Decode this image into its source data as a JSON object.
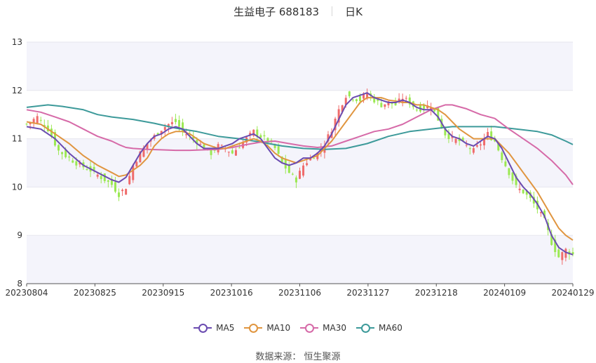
{
  "header": {
    "title": "生益电子 688183",
    "period": "日K"
  },
  "source": "数据来源： 恒生聚源",
  "colors": {
    "up": "#ef6b6b",
    "down": "#9be852",
    "grid_band": "#f4f4fb",
    "grid_line": "#e6e6ee",
    "axis": "#333333"
  },
  "chart_data": {
    "type": "candlestick",
    "title": "生益电子 688183",
    "period_label": "日K",
    "ylim": [
      8,
      13
    ],
    "y_ticks": [
      "8",
      "9",
      "10",
      "11",
      "12",
      "13"
    ],
    "x_tick_labels": [
      "20230804",
      "20230825",
      "20230915",
      "20231016",
      "20231106",
      "20231127",
      "20231218",
      "20240109",
      "20240129"
    ],
    "legend": [
      "MA5",
      "MA10",
      "MA30",
      "MA60"
    ],
    "legend_position": "bottom",
    "candles": {
      "count": 121,
      "close_path": [
        [
          0,
          11.3
        ],
        [
          3,
          11.45
        ],
        [
          6,
          11.2
        ],
        [
          9,
          10.75
        ],
        [
          12,
          10.6
        ],
        [
          15,
          10.45
        ],
        [
          18,
          10.35
        ],
        [
          21,
          10.2
        ],
        [
          24,
          10.05
        ],
        [
          26,
          9.85
        ],
        [
          28,
          10.0
        ],
        [
          30,
          10.45
        ],
        [
          32,
          10.7
        ],
        [
          34,
          10.9
        ],
        [
          36,
          11.05
        ],
        [
          38,
          11.2
        ],
        [
          40,
          11.3
        ],
        [
          42,
          11.35
        ],
        [
          44,
          11.15
        ],
        [
          46,
          11.05
        ],
        [
          48,
          10.95
        ],
        [
          50,
          10.8
        ],
        [
          52,
          10.7
        ],
        [
          54,
          10.85
        ],
        [
          56,
          10.8
        ],
        [
          58,
          10.7
        ],
        [
          60,
          10.85
        ],
        [
          62,
          11.0
        ],
        [
          64,
          11.15
        ],
        [
          66,
          11.05
        ],
        [
          68,
          10.95
        ],
        [
          70,
          10.8
        ],
        [
          72,
          10.5
        ],
        [
          74,
          10.3
        ],
        [
          76,
          10.15
        ],
        [
          78,
          10.45
        ],
        [
          80,
          10.6
        ],
        [
          82,
          10.7
        ],
        [
          84,
          10.9
        ],
        [
          86,
          11.2
        ],
        [
          88,
          11.6
        ],
        [
          90,
          11.9
        ],
        [
          92,
          11.85
        ],
        [
          94,
          11.8
        ],
        [
          96,
          11.95
        ],
        [
          98,
          11.8
        ],
        [
          100,
          11.7
        ],
        [
          102,
          11.75
        ],
        [
          104,
          11.7
        ],
        [
          106,
          11.85
        ],
        [
          108,
          11.75
        ],
        [
          110,
          11.6
        ],
        [
          112,
          11.65
        ],
        [
          114,
          11.7
        ],
        [
          116,
          11.4
        ],
        [
          118,
          11.1
        ],
        [
          120,
          11.0
        ]
      ],
      "note": "x-axis spans 20230804 to 20240129 (120 trading days); later part continues below",
      "close_path_tail": [
        [
          120,
          11.0
        ],
        [
          122,
          10.95
        ],
        [
          124,
          10.85
        ],
        [
          126,
          10.75
        ],
        [
          128,
          10.9
        ],
        [
          130,
          11.1
        ],
        [
          132,
          10.95
        ],
        [
          134,
          10.6
        ],
        [
          136,
          10.3
        ],
        [
          138,
          10.0
        ],
        [
          140,
          9.9
        ],
        [
          142,
          9.75
        ],
        [
          144,
          9.55
        ],
        [
          146,
          9.3
        ],
        [
          148,
          8.85
        ],
        [
          150,
          8.55
        ],
        [
          152,
          8.7
        ],
        [
          154,
          8.6
        ]
      ]
    },
    "ma5": [
      [
        0,
        11.25
      ],
      [
        4,
        11.2
      ],
      [
        8,
        11.0
      ],
      [
        12,
        10.7
      ],
      [
        16,
        10.45
      ],
      [
        20,
        10.3
      ],
      [
        24,
        10.15
      ],
      [
        26,
        10.1
      ],
      [
        28,
        10.2
      ],
      [
        30,
        10.45
      ],
      [
        32,
        10.7
      ],
      [
        34,
        10.9
      ],
      [
        36,
        11.05
      ],
      [
        38,
        11.1
      ],
      [
        40,
        11.2
      ],
      [
        42,
        11.25
      ],
      [
        44,
        11.2
      ],
      [
        46,
        11.05
      ],
      [
        48,
        10.9
      ],
      [
        50,
        10.8
      ],
      [
        52,
        10.8
      ],
      [
        54,
        10.8
      ],
      [
        56,
        10.85
      ],
      [
        58,
        10.9
      ],
      [
        60,
        11.0
      ],
      [
        62,
        11.05
      ],
      [
        64,
        11.1
      ],
      [
        66,
        11.0
      ],
      [
        68,
        10.8
      ],
      [
        70,
        10.6
      ],
      [
        72,
        10.5
      ],
      [
        74,
        10.45
      ],
      [
        76,
        10.5
      ],
      [
        78,
        10.6
      ],
      [
        80,
        10.6
      ],
      [
        82,
        10.7
      ],
      [
        84,
        10.85
      ],
      [
        86,
        11.1
      ],
      [
        88,
        11.4
      ],
      [
        90,
        11.7
      ],
      [
        92,
        11.85
      ],
      [
        94,
        11.9
      ],
      [
        96,
        11.95
      ],
      [
        98,
        11.85
      ],
      [
        100,
        11.8
      ],
      [
        102,
        11.75
      ],
      [
        104,
        11.75
      ],
      [
        106,
        11.8
      ],
      [
        108,
        11.75
      ],
      [
        110,
        11.65
      ],
      [
        112,
        11.6
      ],
      [
        114,
        11.6
      ],
      [
        116,
        11.45
      ],
      [
        118,
        11.2
      ],
      [
        120,
        11.05
      ],
      [
        122,
        11.0
      ],
      [
        124,
        10.9
      ],
      [
        126,
        10.85
      ],
      [
        128,
        10.95
      ],
      [
        130,
        11.05
      ],
      [
        132,
        11.0
      ],
      [
        134,
        10.8
      ],
      [
        136,
        10.5
      ],
      [
        138,
        10.2
      ],
      [
        140,
        10.0
      ],
      [
        142,
        9.85
      ],
      [
        144,
        9.65
      ],
      [
        146,
        9.4
      ],
      [
        148,
        9.0
      ],
      [
        150,
        8.75
      ],
      [
        152,
        8.65
      ],
      [
        154,
        8.6
      ]
    ],
    "ma10": [
      [
        0,
        11.35
      ],
      [
        4,
        11.3
      ],
      [
        8,
        11.1
      ],
      [
        12,
        10.9
      ],
      [
        16,
        10.65
      ],
      [
        20,
        10.45
      ],
      [
        24,
        10.3
      ],
      [
        26,
        10.22
      ],
      [
        28,
        10.25
      ],
      [
        30,
        10.35
      ],
      [
        32,
        10.45
      ],
      [
        34,
        10.6
      ],
      [
        36,
        10.85
      ],
      [
        38,
        11.0
      ],
      [
        40,
        11.1
      ],
      [
        42,
        11.15
      ],
      [
        44,
        11.15
      ],
      [
        46,
        11.1
      ],
      [
        48,
        11.0
      ],
      [
        50,
        10.9
      ],
      [
        52,
        10.85
      ],
      [
        54,
        10.8
      ],
      [
        56,
        10.8
      ],
      [
        58,
        10.85
      ],
      [
        60,
        10.9
      ],
      [
        62,
        10.95
      ],
      [
        64,
        11.0
      ],
      [
        66,
        10.95
      ],
      [
        68,
        10.85
      ],
      [
        70,
        10.7
      ],
      [
        72,
        10.6
      ],
      [
        74,
        10.55
      ],
      [
        76,
        10.5
      ],
      [
        78,
        10.55
      ],
      [
        80,
        10.6
      ],
      [
        82,
        10.65
      ],
      [
        84,
        10.8
      ],
      [
        86,
        10.95
      ],
      [
        88,
        11.15
      ],
      [
        90,
        11.35
      ],
      [
        92,
        11.55
      ],
      [
        94,
        11.75
      ],
      [
        96,
        11.85
      ],
      [
        98,
        11.85
      ],
      [
        100,
        11.85
      ],
      [
        102,
        11.8
      ],
      [
        104,
        11.78
      ],
      [
        106,
        11.75
      ],
      [
        108,
        11.75
      ],
      [
        110,
        11.7
      ],
      [
        112,
        11.7
      ],
      [
        114,
        11.65
      ],
      [
        116,
        11.6
      ],
      [
        118,
        11.5
      ],
      [
        120,
        11.35
      ],
      [
        122,
        11.2
      ],
      [
        124,
        11.1
      ],
      [
        126,
        11.0
      ],
      [
        128,
        11.0
      ],
      [
        130,
        11.0
      ],
      [
        132,
        11.0
      ],
      [
        134,
        10.85
      ],
      [
        136,
        10.7
      ],
      [
        138,
        10.5
      ],
      [
        140,
        10.3
      ],
      [
        142,
        10.1
      ],
      [
        144,
        9.9
      ],
      [
        146,
        9.65
      ],
      [
        148,
        9.4
      ],
      [
        150,
        9.15
      ],
      [
        152,
        9.0
      ],
      [
        154,
        8.9
      ]
    ],
    "ma30": [
      [
        0,
        11.6
      ],
      [
        4,
        11.55
      ],
      [
        8,
        11.45
      ],
      [
        12,
        11.35
      ],
      [
        16,
        11.2
      ],
      [
        20,
        11.05
      ],
      [
        24,
        10.95
      ],
      [
        26,
        10.88
      ],
      [
        28,
        10.82
      ],
      [
        30,
        10.8
      ],
      [
        34,
        10.78
      ],
      [
        38,
        10.77
      ],
      [
        42,
        10.76
      ],
      [
        46,
        10.76
      ],
      [
        50,
        10.77
      ],
      [
        54,
        10.78
      ],
      [
        58,
        10.82
      ],
      [
        62,
        10.88
      ],
      [
        66,
        10.93
      ],
      [
        70,
        10.95
      ],
      [
        74,
        10.9
      ],
      [
        78,
        10.85
      ],
      [
        82,
        10.82
      ],
      [
        86,
        10.85
      ],
      [
        90,
        10.95
      ],
      [
        94,
        11.05
      ],
      [
        98,
        11.15
      ],
      [
        102,
        11.2
      ],
      [
        106,
        11.3
      ],
      [
        110,
        11.45
      ],
      [
        114,
        11.6
      ],
      [
        118,
        11.7
      ],
      [
        120,
        11.7
      ],
      [
        124,
        11.62
      ],
      [
        128,
        11.5
      ],
      [
        132,
        11.42
      ],
      [
        136,
        11.2
      ],
      [
        140,
        11.0
      ],
      [
        144,
        10.8
      ],
      [
        148,
        10.55
      ],
      [
        152,
        10.25
      ],
      [
        154,
        10.05
      ]
    ],
    "ma60": [
      [
        0,
        11.65
      ],
      [
        6,
        11.7
      ],
      [
        10,
        11.67
      ],
      [
        16,
        11.6
      ],
      [
        20,
        11.5
      ],
      [
        24,
        11.45
      ],
      [
        30,
        11.4
      ],
      [
        36,
        11.32
      ],
      [
        42,
        11.22
      ],
      [
        48,
        11.15
      ],
      [
        54,
        11.05
      ],
      [
        60,
        11.0
      ],
      [
        66,
        10.93
      ],
      [
        72,
        10.85
      ],
      [
        78,
        10.8
      ],
      [
        84,
        10.78
      ],
      [
        90,
        10.8
      ],
      [
        96,
        10.9
      ],
      [
        102,
        11.05
      ],
      [
        108,
        11.15
      ],
      [
        114,
        11.2
      ],
      [
        120,
        11.25
      ],
      [
        126,
        11.25
      ],
      [
        132,
        11.25
      ],
      [
        138,
        11.2
      ],
      [
        144,
        11.15
      ],
      [
        148,
        11.08
      ],
      [
        152,
        10.95
      ],
      [
        154,
        10.88
      ]
    ],
    "series_colors": {
      "MA5": "#6a4bb0",
      "MA10": "#e0953f",
      "MA30": "#d66aa8",
      "MA60": "#3d9a9a"
    }
  }
}
